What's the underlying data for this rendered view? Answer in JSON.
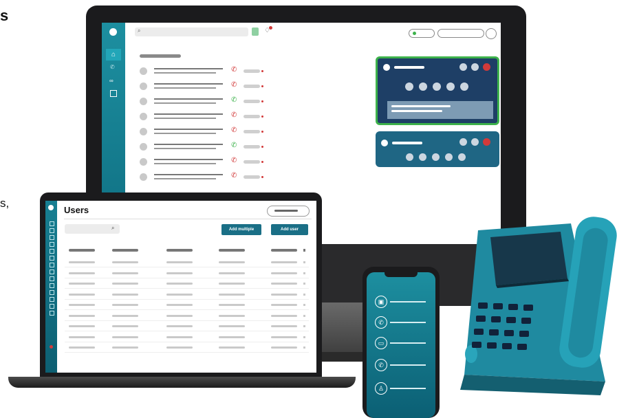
{
  "cut_heading_fragment": "s",
  "cut_text_fragment": "s,",
  "laptop": {
    "title": "Users",
    "add_multiple_label": "Add multiple",
    "add_user_label": "Add user"
  },
  "colors": {
    "brand_teal": "#1d8fa0",
    "card_navy": "#1e3f66",
    "active_green": "#3db24b",
    "missed_red": "#d23a3a",
    "device_black": "#1b1b1d"
  },
  "icons": [
    "search-icon",
    "home-icon",
    "phone-icon",
    "voicemail-icon",
    "contacts-icon",
    "bell-icon",
    "chat-icon",
    "call-icon",
    "missed-call-icon"
  ]
}
